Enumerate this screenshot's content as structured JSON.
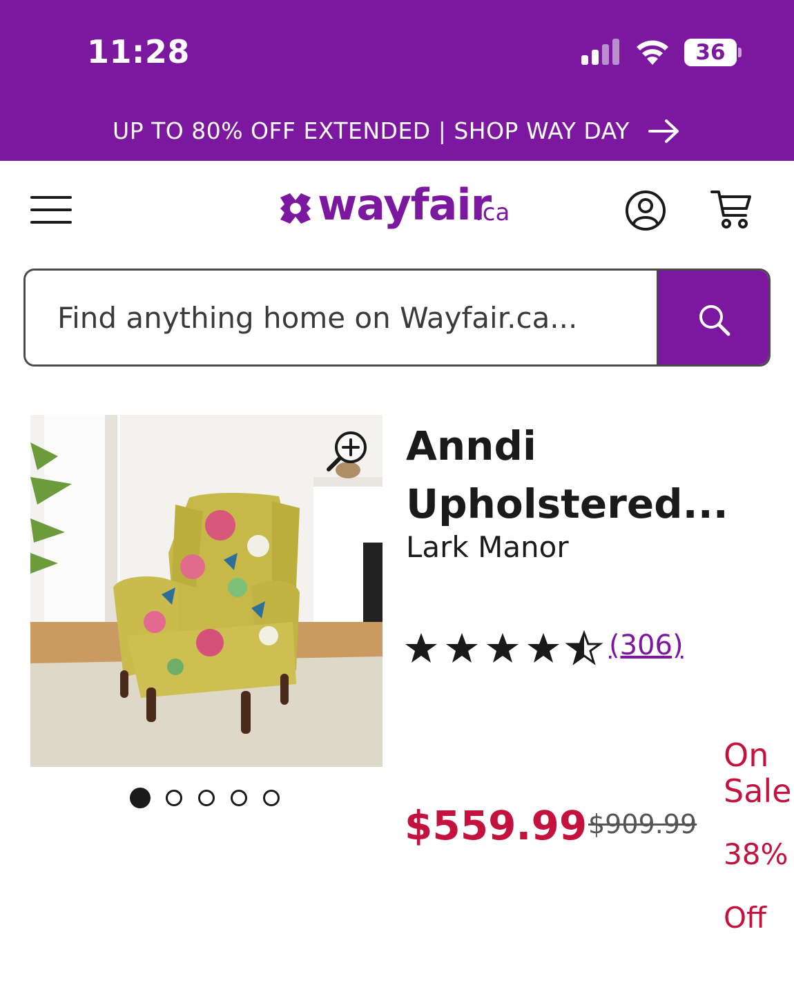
{
  "status_bar": {
    "time": "11:28",
    "battery": "36"
  },
  "promo_banner": {
    "text": "UP TO 80% OFF EXTENDED | SHOP WAY DAY"
  },
  "header": {
    "logo_word": "wayfair",
    "logo_suffix": ".ca"
  },
  "search": {
    "placeholder": "Find anything home on Wayfair.ca..."
  },
  "product": {
    "title": "Anndi Upholstered...",
    "brand": "Lark Manor",
    "rating": 4.5,
    "reviews": "(306)",
    "price": "$559.99",
    "original_price": "$909.99",
    "sale_label": "On Sale",
    "discount": "38% Off",
    "image_count": 5,
    "active_image": 1
  },
  "colors": {
    "brand_purple": "#7b189f",
    "sale_red": "#c2123d"
  },
  "icons": [
    "hamburger-menu-icon",
    "account-icon",
    "cart-icon",
    "search-icon",
    "zoom-in-icon",
    "star-icon",
    "arrow-right-icon",
    "signal-icon",
    "wifi-icon",
    "battery-icon"
  ]
}
